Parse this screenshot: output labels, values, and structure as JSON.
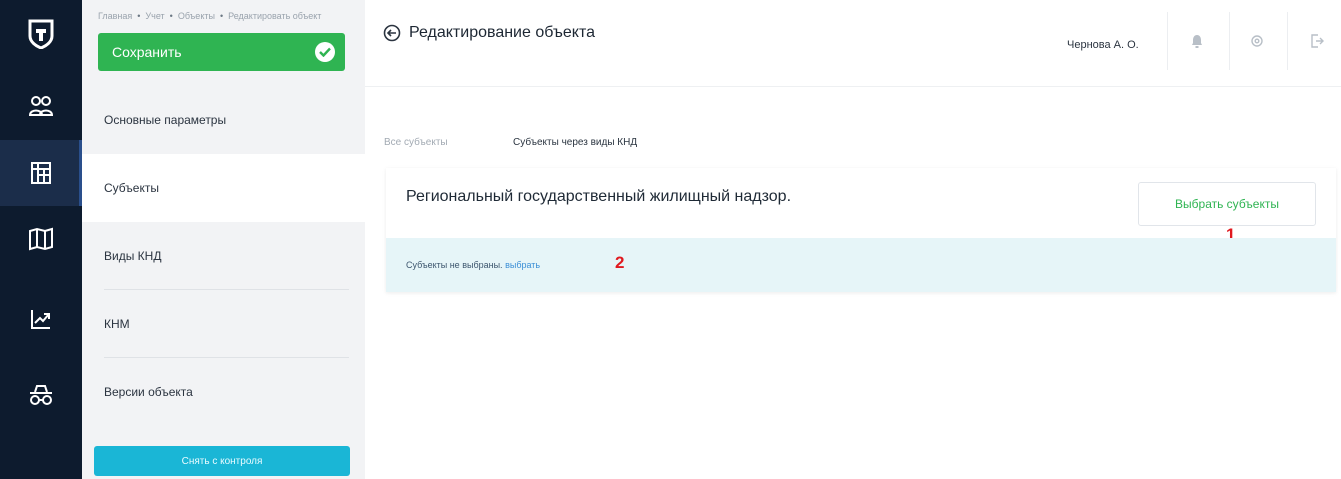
{
  "breadcrumb": [
    "Главная",
    "Учет",
    "Объекты",
    "Редактировать объект"
  ],
  "save_button": {
    "label": "Сохранить"
  },
  "page_title": "Редактирование объекта",
  "user": {
    "name": "Чернова А. О."
  },
  "rail": {
    "icons": [
      "logo-shield-icon",
      "users-icon",
      "building-icon",
      "map-icon",
      "chart-trend-icon",
      "inspector-icon"
    ],
    "active_index": 2
  },
  "menu": {
    "items": [
      "Основные параметры",
      "Субъекты",
      "Виды КНД",
      "КНМ",
      "Версии объекта"
    ],
    "active_index": 1
  },
  "remove_button": {
    "label": "Снять с контроля"
  },
  "tabs": [
    {
      "label": "Все субъекты",
      "active": false
    },
    {
      "label": "Субъекты через виды КНД",
      "active": true
    }
  ],
  "card": {
    "title": "Региональный государственный жилищный надзор.",
    "select_button": "Выбрать субъекты",
    "annotation_1": "1",
    "notice_text": "Субъекты не выбраны.",
    "notice_link": "выбрать",
    "annotation_2": "2"
  },
  "colors": {
    "rail_bg": "#0d1b2e",
    "save_green": "#2fb452",
    "remove_cyan": "#1ab6d6",
    "tab_underline": "#3f6fd4",
    "notice_bg": "#e6f5f8",
    "annotation_red": "#e0191f"
  },
  "header_icons": [
    "bell-icon",
    "settings-icon",
    "logout-icon"
  ]
}
